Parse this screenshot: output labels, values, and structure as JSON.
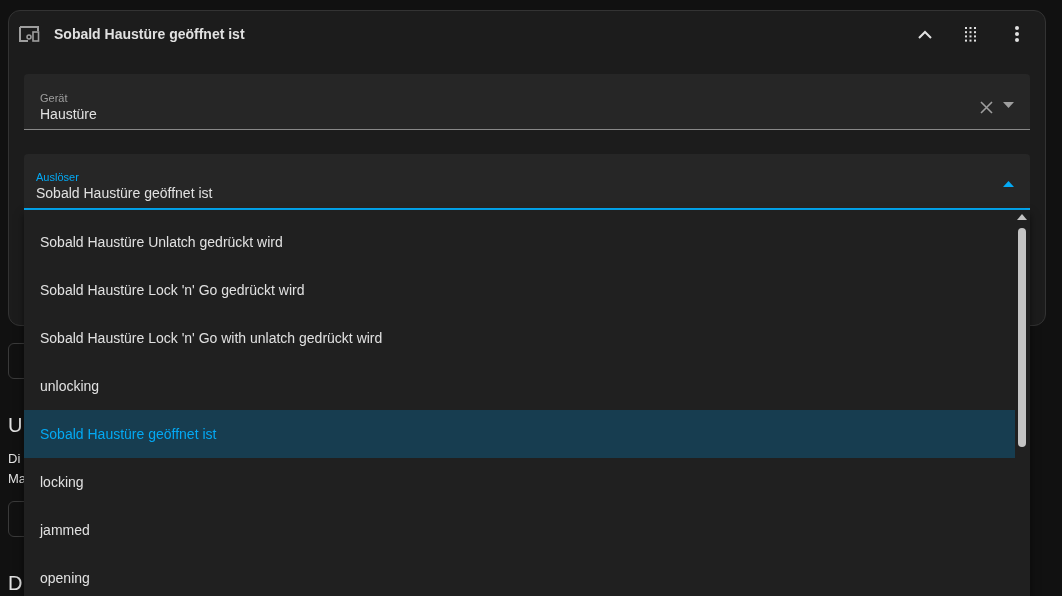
{
  "card": {
    "title": "Sobald Haustüre geöffnet ist",
    "fields": [
      {
        "label": "Gerät",
        "value": "Haustüre",
        "focused": false,
        "clearable": true
      },
      {
        "label": "Auslöser",
        "value": "Sobald Haustüre geöffnet ist",
        "focused": true,
        "clearable": false
      }
    ]
  },
  "background": {
    "heading_1": "U",
    "text_lines": [
      "Di",
      "Ma"
    ],
    "heading_2": "D"
  },
  "menu": {
    "items": [
      {
        "label": "Sobald Haustüre Unlatch gedrückt wird",
        "selected": false
      },
      {
        "label": "Sobald Haustüre Lock 'n' Go gedrückt wird",
        "selected": false
      },
      {
        "label": "Sobald Haustüre Lock 'n' Go with unlatch gedrückt wird",
        "selected": false
      },
      {
        "label": "unlocking",
        "selected": false
      },
      {
        "label": "Sobald Haustüre geöffnet ist",
        "selected": true
      },
      {
        "label": "locking",
        "selected": false
      },
      {
        "label": "jammed",
        "selected": false
      },
      {
        "label": "opening",
        "selected": false
      }
    ]
  }
}
